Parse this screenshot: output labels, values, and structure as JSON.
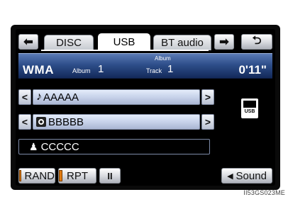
{
  "tabs": {
    "back_icon": "left-arrow-icon",
    "items": [
      {
        "label": "DISC"
      },
      {
        "label": "USB"
      },
      {
        "label": "BT audio"
      }
    ],
    "forward_icon": "right-arrow-icon",
    "return_icon": "return-icon"
  },
  "banner": {
    "album_caption": "Album",
    "format": "WMA",
    "album_label": "Album",
    "album_number": "1",
    "track_label": "Track",
    "track_number": "1",
    "time": "0'11\""
  },
  "rows": {
    "song": {
      "icon": "music-note-icon",
      "text": "AAAAA"
    },
    "album": {
      "icon": "disc-icon",
      "text": "BBBBB"
    },
    "artist": {
      "icon": "person-icon",
      "text": "CCCCC"
    }
  },
  "side": {
    "usb_label": "USB"
  },
  "bottom": {
    "rand_label": "RAND",
    "rpt_label": "RPT",
    "pause_symbol": "II",
    "sound_label": "Sound",
    "rand_active": true,
    "rpt_active": true,
    "accent": "#e07a10"
  },
  "caption": "II53GS023ME"
}
